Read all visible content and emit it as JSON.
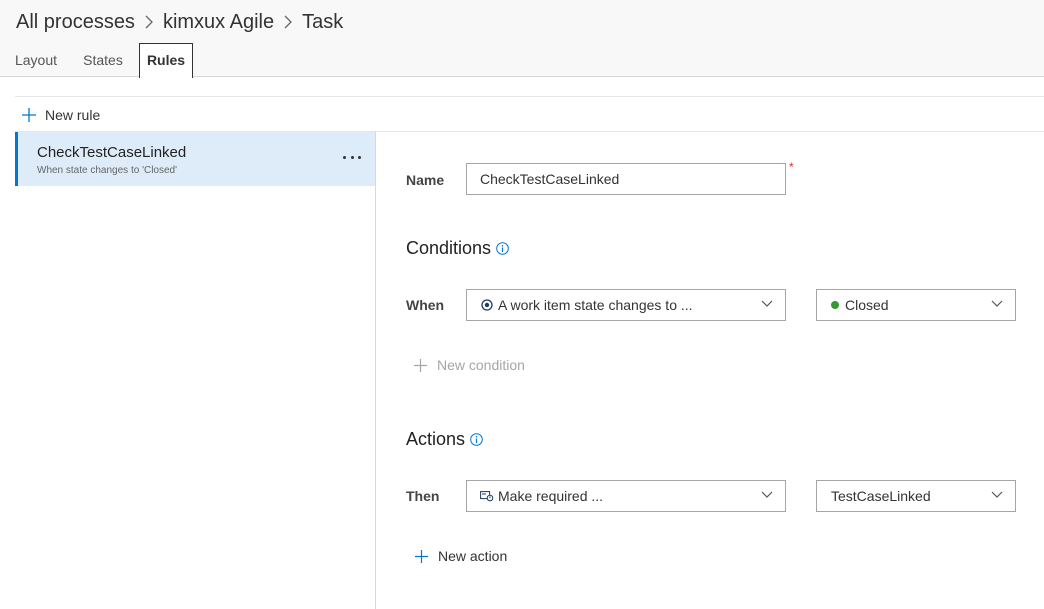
{
  "breadcrumb": {
    "items": [
      "All processes",
      "kimxux Agile",
      "Task"
    ]
  },
  "tabs": [
    "Layout",
    "States",
    "Rules"
  ],
  "toolbar": {
    "new_rule_label": "New rule"
  },
  "rules_list": [
    {
      "name": "CheckTestCaseLinked",
      "description": "When state changes to 'Closed'",
      "more_icon": "ellipsis-icon"
    }
  ],
  "rule_editor": {
    "name_label": "Name",
    "name_value": "CheckTestCaseLinked",
    "required_marker": "*",
    "conditions": {
      "title": "Conditions",
      "when_label": "When",
      "condition_type": "A work item state changes to ...",
      "condition_value": "Closed",
      "condition_value_color": "#339933",
      "new_condition_label": "New condition"
    },
    "actions": {
      "title": "Actions",
      "then_label": "Then",
      "action_type": "Make required ...",
      "action_field": "TestCaseLinked",
      "new_action_label": "New action"
    }
  },
  "colors": {
    "accent": "#0078d4",
    "selected_row": "#deecf9",
    "required": "#d13438"
  }
}
